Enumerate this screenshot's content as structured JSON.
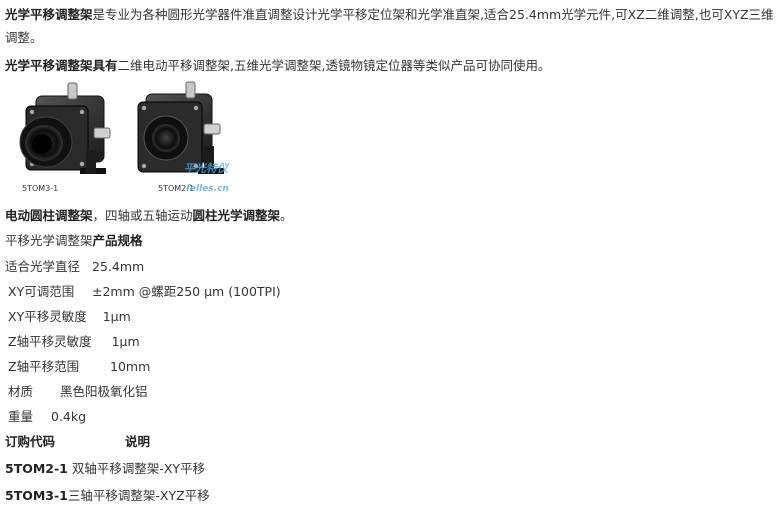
{
  "intro": {
    "bold": "光学平移调整架",
    "text": "是专业为各种圆形光学器件准直调整设计光学平移定位架和光学准直架,适合25.4mm光学元件,可XZ二维调整,也可XYZ三维调整。"
  },
  "similar": {
    "bold": "光学平移调整架具有",
    "text": "二维电动平移调整架,五维光学调整架,透镜物镜定位器等类似产品可协同使用。"
  },
  "photo": {
    "label_left": "5TOM3-1",
    "label_right": "5TOM2-1",
    "watermark_top": "平光特仪",
    "watermark_bottom": "felles.cn"
  },
  "note": {
    "bold1": "电动圆柱调整架",
    "mid": "，四轴或五轴运动",
    "bold2": "圆柱光学调整架",
    "end": "。"
  },
  "spec_heading": {
    "normal": "平移光学调整架",
    "bold": "产品规格"
  },
  "specs": [
    {
      "label": "适合光学直径",
      "value": "25.4mm"
    },
    {
      "label": "XY可调范围",
      "value": "±2mm @螺距250 µm (100TPI)"
    },
    {
      "label": "XY平移灵敏度",
      "value": "1µm"
    },
    {
      "label": "Z轴平移灵敏度",
      "value": "1µm"
    },
    {
      "label": "Z轴平移范围",
      "value": "10mm"
    },
    {
      "label": "材质",
      "value": "黑色阳极氧化铝"
    },
    {
      "label": "重量",
      "value": "0.4kg"
    }
  ],
  "order_header": {
    "code": "订购代码",
    "desc": "说明"
  },
  "orders": [
    {
      "code": "5TOM2-1",
      "desc": "双轴平移调整架-XY平移"
    },
    {
      "code": "5TOM3-1",
      "desc": "三轴平移调整架-XYZ平移"
    }
  ]
}
